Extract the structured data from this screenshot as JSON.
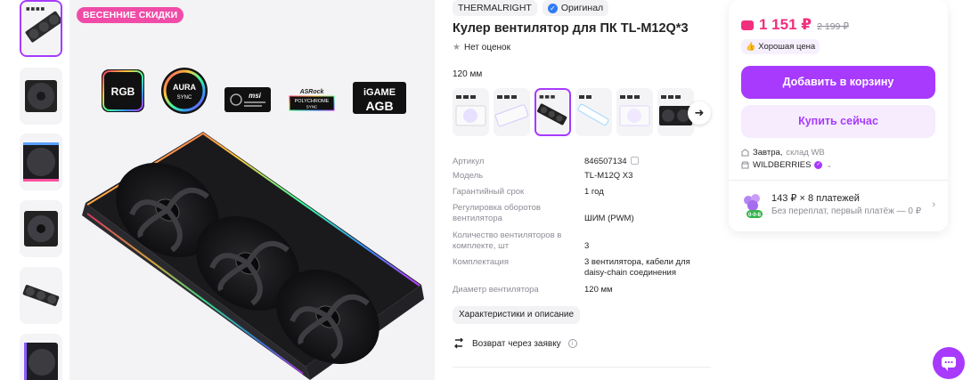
{
  "gallery": {
    "promo_badge": "ВЕСЕННИЕ СКИДКИ",
    "logos": [
      "RGB",
      "AURA",
      "SYNC",
      "msi",
      "ASRock",
      "POLYCHROME SYNC",
      "iGAME",
      "AGB"
    ]
  },
  "product": {
    "brand": "THERMALRIGHT",
    "original_label": "Оригинал",
    "title": "Кулер вентилятор для ПК TL-M12Q*3",
    "rating_text": "Нет оценок",
    "size_label": "120 мм"
  },
  "specs": [
    {
      "key": "Артикул",
      "value": "846507134"
    },
    {
      "key": "Модель",
      "value": "TL-M12Q X3"
    },
    {
      "key": "Гарантийный срок",
      "value": "1 год"
    },
    {
      "key": "Регулировка оборотов вентилятора",
      "value": "ШИМ (PWM)"
    },
    {
      "key": "Количество вентиляторов в комплекте, шт",
      "value": "3"
    },
    {
      "key": "Комплектация",
      "value": "3 вентилятора, кабели для daisy-chain соединения"
    },
    {
      "key": "Диаметр вентилятора",
      "value": "120 мм"
    }
  ],
  "actions": {
    "specs_button": "Характеристики и описание",
    "return_text": "Возврат через заявку"
  },
  "buy": {
    "price": "1 151 ₽",
    "old_price": "2 199 ₽",
    "good_price": "Хорошая цена",
    "add_to_cart": "Добавить в корзину",
    "buy_now": "Купить сейчас",
    "delivery_day": "Завтра,",
    "delivery_warehouse": "склад WB",
    "seller": "WILDBERRIES",
    "installment_title": "143 ₽ × 8 платежей",
    "installment_sub": "Без переплат, первый платёж — 0 ₽",
    "installment_badge": "0-0-8"
  },
  "colors": {
    "accent": "#a73afd",
    "price": "#f0307e",
    "promo": "#f04ba7"
  }
}
